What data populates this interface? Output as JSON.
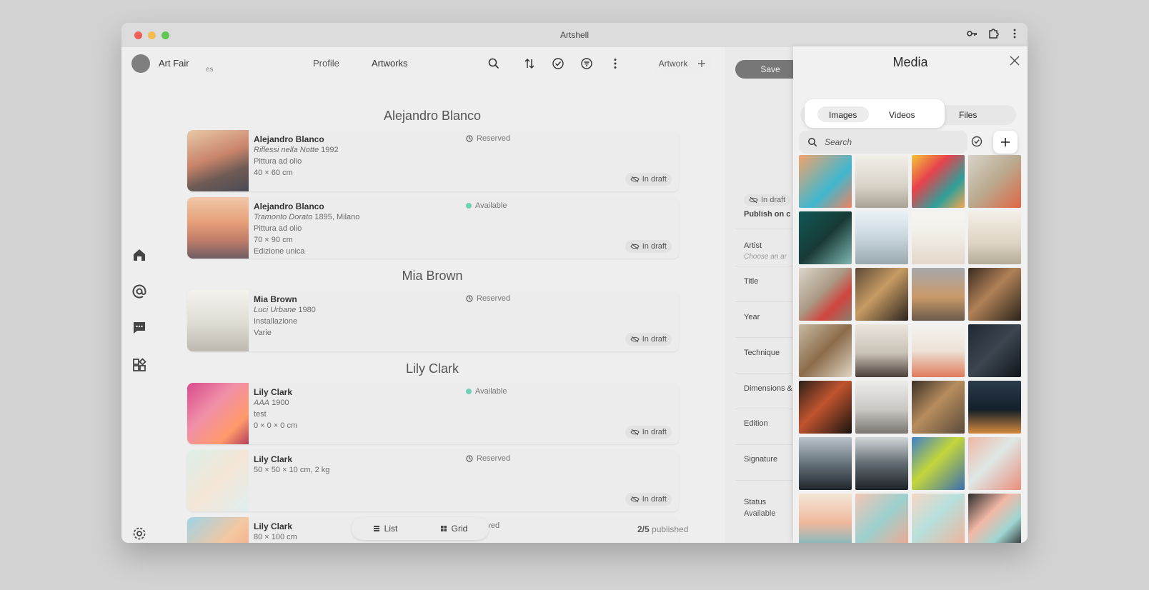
{
  "window": {
    "title": "Artshell"
  },
  "header": {
    "account_name": "Art Fair",
    "account_sub": "es",
    "tabs": [
      "Profile",
      "Artworks"
    ],
    "artwork_button": "Artwork"
  },
  "groups": [
    {
      "title": "Alejandro Blanco"
    },
    {
      "title": "Mia Brown"
    },
    {
      "title": "Lily Clark"
    }
  ],
  "artworks": [
    {
      "artist": "Alejandro Blanco",
      "title": "Riflessi nella Notte",
      "meta": "1992",
      "technique": "Pittura ad olio",
      "size": "40 × 60 cm",
      "extra": "",
      "status": "Reserved",
      "draft": "In draft",
      "thumb": "linear-gradient(160deg,#e9c9a8,#c9846a 45%,#6f5b55 70%,#4b4a55)"
    },
    {
      "artist": "Alejandro Blanco",
      "title": "Tramonto Dorato",
      "meta": "1895, Milano",
      "technique": "Pittura ad olio",
      "size": "70 × 90 cm",
      "extra": "Edizione unica",
      "status": "Available",
      "draft": "In draft",
      "thumb": "linear-gradient(180deg,#f1c8a8,#e6a07a 40%,#c07d68 70%,#6f5d64)"
    },
    {
      "artist": "Mia Brown",
      "title": "Luci Urbane",
      "meta": "1980",
      "technique": "Installazione",
      "size": "Varie",
      "extra": "",
      "status": "Reserved",
      "draft": "In draft",
      "thumb": "linear-gradient(180deg,#f5f3ee,#dedbd3 55%,#bdb9b0)"
    },
    {
      "artist": "Lily Clark",
      "title": "AAA",
      "meta": "1900",
      "technique": "test",
      "size": "0 × 0 × 0 cm",
      "extra": "",
      "status": "Available",
      "draft": "In draft",
      "thumb": "linear-gradient(135deg,#d94c8c,#f08fa8 40%,#ff9a6a 75%,#b53f5c)"
    },
    {
      "artist": "Lily Clark",
      "title": "",
      "meta": "",
      "technique": "50 × 50 × 10 cm, 2 kg",
      "size": "",
      "extra": "",
      "status": "Reserved",
      "draft": "In draft",
      "thumb": "linear-gradient(135deg,#dcefe9,#f4e6d6 50%,#e0eef0)"
    },
    {
      "artist": "Lily Clark",
      "title": "",
      "meta": "",
      "technique": "80 × 100 cm",
      "size": "",
      "extra": "",
      "status": "Reserved",
      "draft": "",
      "thumb": "linear-gradient(135deg,#9fd3e6,#f4c7a0 50%,#f09a7e)"
    }
  ],
  "footer": {
    "view_list": "List",
    "view_grid": "Grid",
    "published_count": "2/5",
    "published_label": "published"
  },
  "form": {
    "save": "Save",
    "draft": "In draft",
    "publish_on": "Publish on c",
    "fields": [
      {
        "label": "Artist",
        "placeholder": "Choose an ar"
      },
      {
        "label": "Title",
        "placeholder": ""
      },
      {
        "label": "Year",
        "placeholder": ""
      },
      {
        "label": "Technique",
        "placeholder": ""
      },
      {
        "label": "Dimensions &",
        "placeholder": ""
      },
      {
        "label": "Edition",
        "placeholder": ""
      },
      {
        "label": "Signature",
        "placeholder": ""
      },
      {
        "label": "Status",
        "placeholder": ""
      }
    ],
    "status_value": "Available"
  },
  "media": {
    "title": "Media",
    "tabs": [
      "Images",
      "Videos",
      "Files"
    ],
    "active_tab": "Images",
    "search_placeholder": "Search",
    "tiles": [
      "linear-gradient(135deg,#f3a36b,#3fb7cf 60%,#f0825f)",
      "linear-gradient(180deg,#f2efe9,#d8d2c6 60%,#a9a195)",
      "linear-gradient(135deg,#f3c53a,#e8424c 35%,#2e9f9a 70%,#f7a64e)",
      "linear-gradient(135deg,#d9d3c9,#b9a98e 50%,#e06646)",
      "linear-gradient(135deg,#0f5855,#183a36 50%,#7fb7b0)",
      "linear-gradient(180deg,#e8f2f6,#c8d6dc 50%,#9aa9ae)",
      "linear-gradient(180deg,#f7f5f1,#f2efe8 40%,#e3d7c9)",
      "linear-gradient(180deg,#f3efe6,#ddd4c3 60%,#b5ab98)",
      "linear-gradient(135deg,#dcd6cb,#a99a84 45%,#d1453f 70%,#8a7e6c)",
      "linear-gradient(135deg,#5e4a39,#c79b63 45%,#2d2520)",
      "linear-gradient(180deg,#a6a7aa,#ca9a6a 55%,#6b5a4a)",
      "linear-gradient(135deg,#3a2a1f,#b08157 45%,#2b231c)",
      "linear-gradient(135deg,#c8b9a3,#8b6c4a 50%,#e0d5c4)",
      "linear-gradient(180deg,#ebe6dd,#c9c1b5 55%,#4b4038)",
      "linear-gradient(180deg,#f4f2ee,#ece2d6 50%,#e07b5a)",
      "linear-gradient(135deg,#1f2933,#3c4650 50%,#0f1419)",
      "linear-gradient(135deg,#2a2019,#c1542f 45%,#1a1410)",
      "linear-gradient(180deg,#ececea,#c9c7c2 55%,#7a7570)",
      "linear-gradient(135deg,#3b3127,#b78d5e 45%,#5a4a3a)",
      "linear-gradient(180deg,#2c3b4a,#13202b 55%,#d58a3e)",
      "linear-gradient(180deg,#b9c4cb,#5e6a72 55%,#1f262b)",
      "linear-gradient(180deg,#d2d6d8,#616b71 50%,#1d2226)",
      "linear-gradient(135deg,#3f7fc8,#c4d63a 45%,#3a6fb0)",
      "linear-gradient(135deg,#f0b7a5,#dfe7e6 45%,#e98f7c)",
      "linear-gradient(180deg,#f3e7d6,#f0b89d 55%,#7bb9c0)",
      "linear-gradient(135deg,#f4c6b5,#9bd0cf 50%,#f0a88e)",
      "linear-gradient(135deg,#f6d6c5,#b7e0dc 45%,#f0b39a)",
      "linear-gradient(135deg,#2c2c2c,#f2b8a6 40%,#9fd6d2 70%,#2c2c2c)",
      "linear-gradient(180deg,#7a4a35,#e2b797 55%,#3a2a20)",
      "linear-gradient(180deg,#c85a4e,#3f8a5a 55%,#1d3a2a)",
      "linear-gradient(180deg,#f2ede5,#d7c8b6 55%,#a58d74)",
      "linear-gradient(180deg,#f4efe9,#1f1f1f 50%,#f1b89a)"
    ]
  },
  "colors": {
    "accent_available": "#6fd1b5",
    "save_button": "#777777"
  }
}
